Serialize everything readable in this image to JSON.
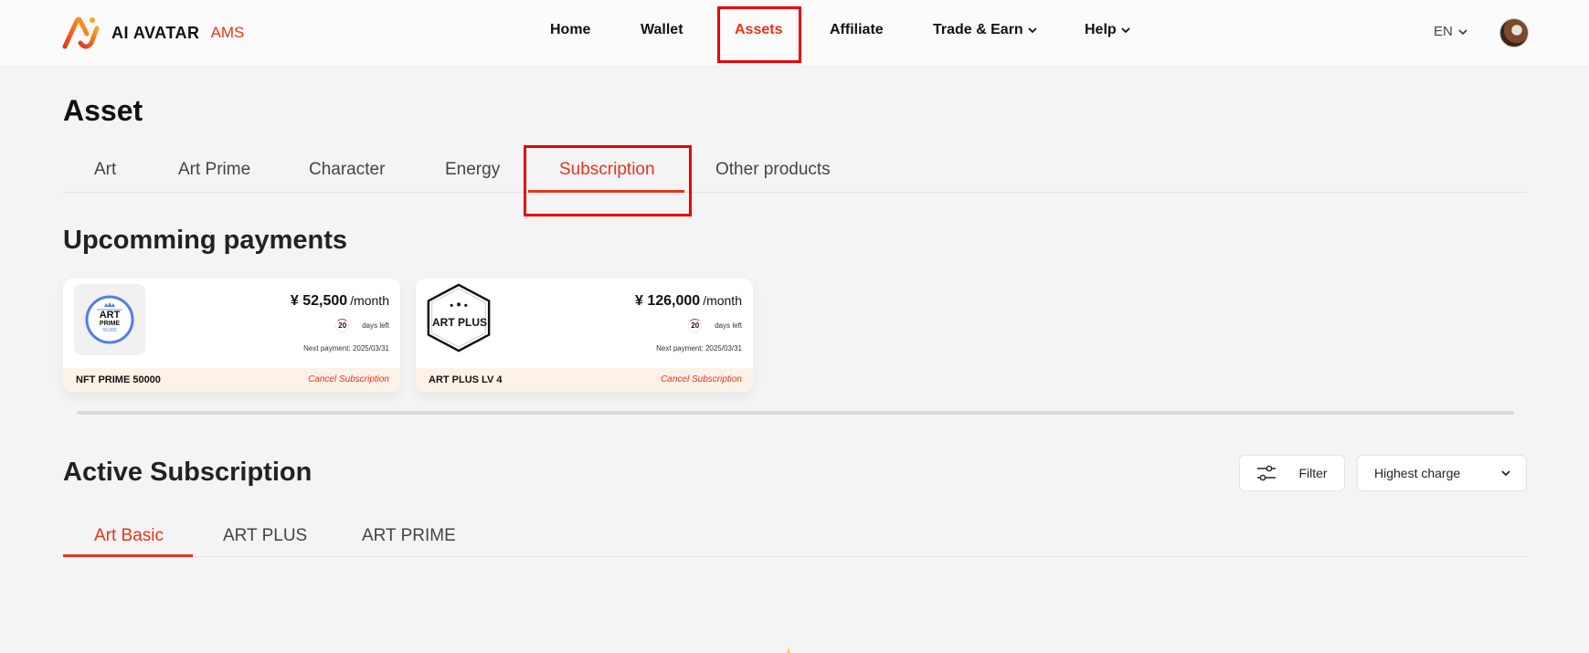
{
  "header": {
    "brand": "AI AVATAR",
    "brand_suffix": "AMS",
    "nav": [
      {
        "label": "Home"
      },
      {
        "label": "Wallet"
      },
      {
        "label": "Assets"
      },
      {
        "label": "Affiliate"
      },
      {
        "label": "Trade & Earn"
      },
      {
        "label": "Help"
      }
    ],
    "language": "EN"
  },
  "page": {
    "title": "Asset",
    "tabs": [
      {
        "label": "Art"
      },
      {
        "label": "Art Prime"
      },
      {
        "label": "Character"
      },
      {
        "label": "Energy"
      },
      {
        "label": "Subscription"
      },
      {
        "label": "Other products"
      }
    ],
    "active_tab": "Subscription"
  },
  "upcoming": {
    "title": "Upcomming payments",
    "cards": [
      {
        "thumb_line1": "ART",
        "thumb_line2": "PRIME",
        "thumb_line3": "50,000",
        "price": "¥ 52,500",
        "per": "/month",
        "days": "20",
        "days_label": "days left",
        "next_payment": "Next payment: 2025/03/31",
        "name": "NFT PRIME 50000",
        "cancel": "Cancel Subscription"
      },
      {
        "thumb_line1": "ART PLUS",
        "price": "¥ 126,000",
        "per": "/month",
        "days": "20",
        "days_label": "days left",
        "next_payment": "Next payment: 2025/03/31",
        "name": "ART PLUS LV 4",
        "cancel": "Cancel Subscription"
      }
    ]
  },
  "active": {
    "title": "Active Subscription",
    "filter_label": "Filter",
    "sort_value": "Highest charge",
    "tabs": [
      {
        "label": "Art Basic"
      },
      {
        "label": "ART PLUS"
      },
      {
        "label": "ART PRIME"
      }
    ],
    "active_tab": "Art Basic"
  },
  "colors": {
    "accent": "#e8341c",
    "highlight_box": "#ee0000",
    "card_footer": "#fdf2e7",
    "prime_badge_blue": "#4f7ee6"
  }
}
